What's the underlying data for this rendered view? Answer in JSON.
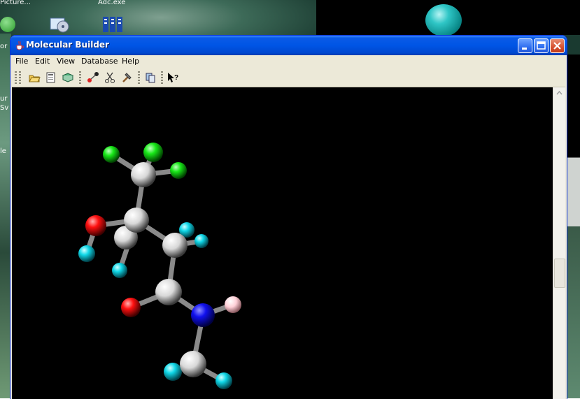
{
  "desktop": {
    "icons": [
      {
        "label": "Picture..."
      },
      {
        "label": "Adc.exe"
      }
    ],
    "side_labels": [
      "or",
      "ur",
      "Sv",
      "le"
    ]
  },
  "window": {
    "title": "Molecular Builder",
    "menu": [
      "File",
      "Edit",
      "View",
      "Database",
      "Help"
    ],
    "toolbar_icons": [
      "open-folder-icon",
      "save-icon",
      "book-icon",
      "link-atoms-icon",
      "cut-icon",
      "build-hammer-icon",
      "copy-icon",
      "context-help-icon"
    ]
  },
  "molecule": {
    "atom_colors": {
      "carbon": "#ffffff",
      "oxygen": "#ff1010",
      "nitrogen": "#1010ff",
      "fluorine": "#1aff1a",
      "hydrogen": "#10e0f0",
      "polar_hydrogen": "#ffd0d8"
    }
  },
  "colors": {
    "titlebar": "#0055e5",
    "window_bg": "#ece9d8",
    "viewport_bg": "#000000"
  }
}
